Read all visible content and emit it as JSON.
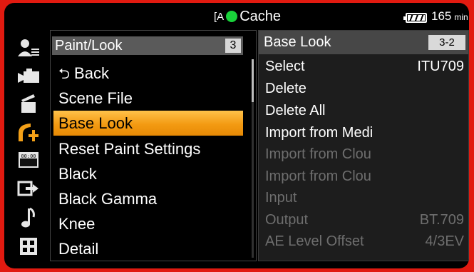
{
  "status": {
    "media_glyph": "[A",
    "title": "Cache",
    "rec_color": "#19d23a",
    "battery_value": "165",
    "battery_unit": "min"
  },
  "icons": [
    "user-menu-icon",
    "camera-icon",
    "clapper-icon",
    "paint-icon",
    "timecode-icon",
    "output-icon",
    "audio-icon",
    "thumbnail-icon"
  ],
  "menu": {
    "title": "Paint/Look",
    "page": "3",
    "items": [
      {
        "label": "Back"
      },
      {
        "label": "Scene File"
      },
      {
        "label": "Base Look"
      },
      {
        "label": "Reset Paint Settings"
      },
      {
        "label": "Black"
      },
      {
        "label": "Black Gamma"
      },
      {
        "label": "Knee"
      },
      {
        "label": "Detail"
      }
    ],
    "selected_index": 2
  },
  "panel": {
    "title": "Base Look",
    "page": "3-2",
    "rows": [
      {
        "label": "Select",
        "value": "ITU709",
        "enabled": true
      },
      {
        "label": "Delete",
        "value": "",
        "enabled": true
      },
      {
        "label": "Delete All",
        "value": "",
        "enabled": true
      },
      {
        "label": "Import from Medi",
        "value": "",
        "enabled": true
      },
      {
        "label": "Import from Clou",
        "value": "",
        "enabled": false
      },
      {
        "label": "Import from Clou",
        "value": "",
        "enabled": false
      },
      {
        "label": "Input",
        "value": "",
        "enabled": false
      },
      {
        "label": "Output",
        "value": "BT.709",
        "enabled": false
      },
      {
        "label": "AE Level Offset",
        "value": "4/3EV",
        "enabled": false
      }
    ]
  },
  "colors": {
    "frame": "#e11a10",
    "highlight": "#f39a12",
    "dim_text": "#6e6e6e"
  }
}
